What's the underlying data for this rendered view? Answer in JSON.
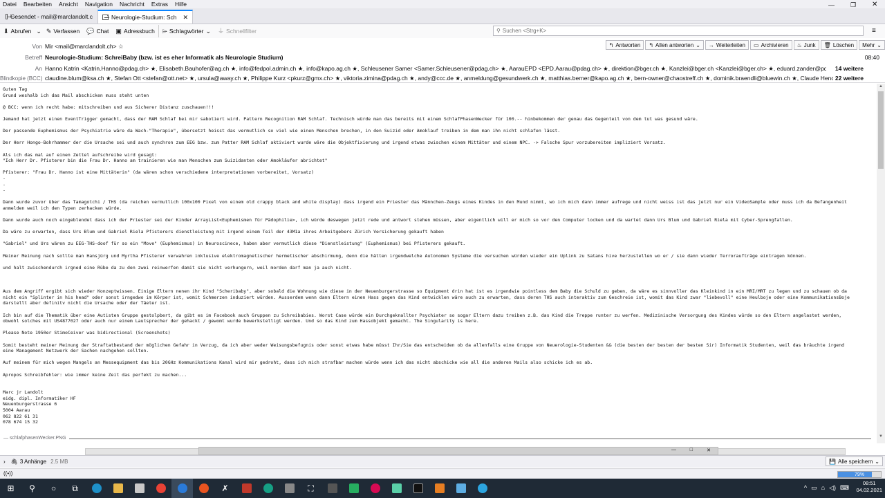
{
  "menubar": [
    "Datei",
    "Bearbeiten",
    "Ansicht",
    "Navigation",
    "Nachricht",
    "Extras",
    "Hilfe"
  ],
  "tabs": [
    {
      "label": "Gesendet - mail@marclandolt.c",
      "active": false
    },
    {
      "label": "Neurologie-Studium: Schreib",
      "active": true
    }
  ],
  "toolbar": {
    "abrufen": "Abrufen",
    "verfassen": "Verfassen",
    "chat": "Chat",
    "adressbuch": "Adressbuch",
    "schlagwoerter": "Schlagwörter",
    "schnellfilter": "Schnellfilter",
    "search_placeholder": "Suchen <Strg+K>"
  },
  "header": {
    "von_label": "Von",
    "von": "Mir <mail@marclandolt.ch>",
    "betreff_label": "Betreff",
    "betreff": "Neurologie-Studium: SchreiBaby (bzw. ist es eher Informatik als Neurologie Studium)",
    "an_label": "An",
    "an": "Hanno Katrin <Katrin.Hanno@pdag.ch> ★, Elisabeth.Bauhofer@ag.ch ★, info@fedpol.admin.ch ★, info@kapo.ag.ch ★, Schleusener Samer <Samer.Schleusener@pdag.ch> ★, AarauEPD <EPD.Aarau@pdag.ch> ★, direktion@bger.ch ★, Kanzlei@bger.ch <Kanzlei@bger.ch> ★, eduard.zander@pdag.ch ★",
    "an_more": "14 weitere",
    "bcc_label": "Blindkopie (BCC)",
    "bcc": "claudine.blum@ksa.ch ★, Stefan Ott <stefan@ott.net> ★, ursula@away.ch ★, Philippe Kurz <pkurz@gmx.ch> ★, viktoria.zimina@pdag.ch ★, andy@ccc.de ★, anmeldung@gesundwerk.ch ★, matthias.berner@kapo.ag.ch ★, bern-owner@chaostreff.ch ★, dominik.braendli@bluewin.ch ★, Claude Henchoz <claude.henchc",
    "bcc_more": "22 weitere",
    "time": "08:40",
    "buttons": [
      "Antworten",
      "Allen antworten",
      "Weiterleiten",
      "Archivieren",
      "Junk",
      "Löschen",
      "Mehr"
    ]
  },
  "body": "Guten Tag\nGrund weshalb ich das Mail abschicken muss steht unten\n\n@ BCC: wenn ich recht habe: mitschreiben und aus Sicherer Distanz zuschauen!!!\n\nJemand hat jetzt einen EventTrigger gemacht, dass der RAM Schlaf bei mir sabotiert wird. Pattern Recognition RAM Schlaf. Technisch würde man das bereits mit einem SchlafPhasenWecker für 100.-- hinbekommen der genau das Gegenteil von dem tut was gesund wäre.\n\nDer passende Euphemismus der Psychiatrie wäre da Wach-\"Therapie\", übersetzt heisst das vermutlich so viel wie einen Menschen brechen, in den Suizid oder Amoklauf treiben in dem man ihn nicht schlafen lässt.\n\nDer Herr Hongo-Bohrhammer der die Ursache sei und auch synchron zum EEG bzw. zum Patter RAM Schlaf aktiviert wurde wäre die Objektfixierung und irgend etwas zwischen einem Mittäter und einem NPC. -> Falsche Spur vorzubereiten impliziert Vorsatz.\n\nAls ich das mal auf einen Zettel aufschreibe wird gesagt:\n\"Ich Herr Dr. Pfisterer bin die Frau Dr. Hanno am trainieren wie man Menschen zum Suizidanten oder Amokläufer abrichtet\"\n\nPfisterer: \"Frau Dr. Hanno ist eine Mittäterin\" (da wären schon verschiedene interpretationen vorbereitet, Vorsatz)\n-\n-\n-\n\nDann wurde zuvor über das Tamagotchi / THS (da reichen vermutlich 100x100 Pixel von einem old crappy black and white display) dass irgend ein Priester das Männchen-Zeugs eines Kindes in den Mund nimmt, wo ich mich dann immer aufrege und nicht weiss ist das jetzt nur ein VideoSample oder muss ich da Befangenheit\nanmelden weil ich den Typen zerhacken würde.\n\nDann wurde auch noch eingeblendet dass ich der Priester sei der Kinder ArrayList<Euphemismen für Pädophilie>, ich würde deswegen jetzt rede und antwort stehen müssen, aber eigentlich will er mich so vor den Computer locken und da wartet dann Urs Blum und Gabriel Riela mit Cyber-Sprengfallen.\n\nDa wäre zu erwarten, dass Urs Blum und Gabriel Riela Pfisterers dienstleistung mit irgend einem Teil der 43M1a ihres Arbeitgebers Zürich Versicherung gekauft haben\n\n\"Gabriel\" und Urs wären zu EEG-THS-doof für so ein \"Move\" (Euphemismus) in Neuroscinece, haben aber vermutlich diese \"Dienstleistung\" (Euphemismus) bei Pfisterers gekauft.\n\nMeiner Meinung nach sollte man Hansjürg und Myrtha Pfisterer verwahren inklusive elektromagnetischer hermetischer abschirmung, denn die hätten irgendwelche Autonomen Systeme die versuchen würden wieder ein Uplink zu Satans hive herzustellen wo er / sie dann wieder Terroraufträge eintragen können.\n\nund halt zwischendurch irgned eine Rübe da zu den zwei reinwerfen damit sie nicht verhungern, weil morden darf man ja auch nicht.\n\n\n\nAus dem Angriff ergibt sich wieder Konzeptwissen. Einige Eltern nenen ihr Kind \"Scheribaby\", aber sobald die Wohnung wie diese in der Neuenburgerstrasse so Equipment drin hat ist es irgendwie pointless dem Baby die Schuld zu geben, da wäre es sinnvoller das Kleinkind in ein MRI/MRT zu legen und zu schauen ob da\nnicht ein \"Splinter in his head\" oder sonst irngedwo im Körper ist, womit Schmerzen induziert würden. Ausserdem wenn dann Eltern einen Hass gegen das Kind entwicklen wäre auch zu erwarten, dass deren THS auch interaktiv zum Geschreie ist, womit das Kind zwar \"liebevoll\" eine Heulboje oder eine KommunikationsBoje\ndarstellt aber definitv nicht die Ursache oder der Täeter ist.\n\nIch bin auf die Thematik über eine Autisten Gruppe gestolpbert, da gibt es im Facebook auch Gruppen zu Schreibabies. Worst Case würde ein Durchgeknallter Psychiater so sogar Eltern dazu treiben z.B. das Kind die Treppe runter zu werfen. Medizinische Versorgung des Kindes würde so den Eltern angelastet werden,\nobwohl solches mit US4877027 oder auch nur einem Lautsprecher der gehackt / gewomt wurde bewerkstelligt werden. Und so das Kind zum Hassobjekt gemacht. The Singularity is here.\n\nPlease Note 1950er StimoCeiver was bidirectional (Screenshots)\n\nSomit besteht meiner Meinung der Straftatbestand der möglichen Gefahr in Verzug, da ich aber weder Weisungsbefugnis oder sonst etwas habe müsst Ihr/Sie das entscheiden ob da allenfalls eine Gruppe von Neuerologie-Studenten && (die besten der besten der besten Sir) Informatik Studenten, weil das bräuchte irgend\neine Management Netzwerk der Sachen nachgehen sollten.\n\nAuf meinem für mich wegen Mangels an Messequipment das bis 20GHz Kommunikations Kanal wird mir gedroht, dass ich mich strafbar machen würde wenn ich das nicht abschicke wie all die anderen Mails also schicke ich es ab.\n\nApropos Schreibfehler: wie immer keine Zeit das perfekt zu machen...\n\n\nMarc jr Landolt\neidg. dipl. Informatiker HF\nNeuenburgerstrasse 6\n5004 Aarau\n062 822 61 31\n078 674 15 32",
  "attachment_line": "— schlafphasenWecker.PNG",
  "attachments": {
    "count": "3 Anhänge",
    "size": "2.5 MB",
    "save_all": "Alle speichern"
  },
  "status": {
    "progress": 79,
    "progress_label": "79%"
  },
  "clock": {
    "time": "08:51",
    "date": "04.02.2021"
  }
}
